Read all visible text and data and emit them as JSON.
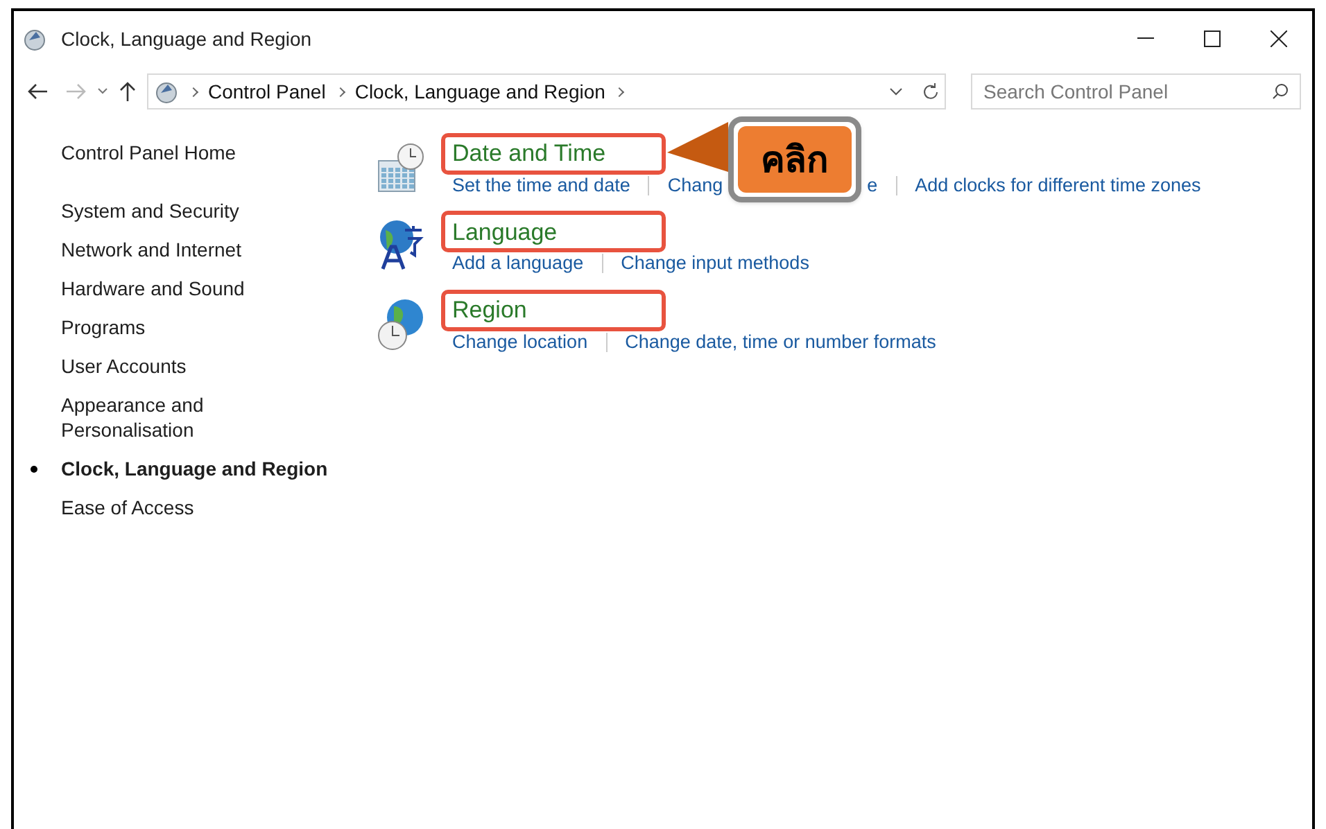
{
  "window": {
    "title": "Clock, Language and Region"
  },
  "address_bar": {
    "breadcrumbs": [
      "Control Panel",
      "Clock, Language and Region"
    ]
  },
  "search": {
    "placeholder": "Search Control Panel"
  },
  "sidebar": {
    "home": "Control Panel Home",
    "items": [
      {
        "label": "System and Security",
        "selected": false
      },
      {
        "label": "Network and Internet",
        "selected": false
      },
      {
        "label": "Hardware and Sound",
        "selected": false
      },
      {
        "label": "Programs",
        "selected": false
      },
      {
        "label": "User Accounts",
        "selected": false
      },
      {
        "label": "Appearance and Personalisation",
        "selected": false
      },
      {
        "label": "Clock, Language and Region",
        "selected": true
      },
      {
        "label": "Ease of Access",
        "selected": false
      }
    ]
  },
  "categories": [
    {
      "kind": "clock",
      "title": "Date and Time",
      "links": [
        {
          "parts": [
            "Set the time and date"
          ]
        },
        {
          "parts": [
            "Chang",
            "e"
          ]
        },
        {
          "parts": [
            "Add clocks for different time zones"
          ]
        }
      ]
    },
    {
      "kind": "language",
      "title": "Language",
      "links": [
        {
          "parts": [
            "Add a language"
          ]
        },
        {
          "parts": [
            "Change input methods"
          ]
        }
      ]
    },
    {
      "kind": "region",
      "title": "Region",
      "links": [
        {
          "parts": [
            "Change location"
          ]
        },
        {
          "parts": [
            "Change date, time or number formats"
          ]
        }
      ]
    }
  ],
  "callout": {
    "text": "คลิก"
  }
}
